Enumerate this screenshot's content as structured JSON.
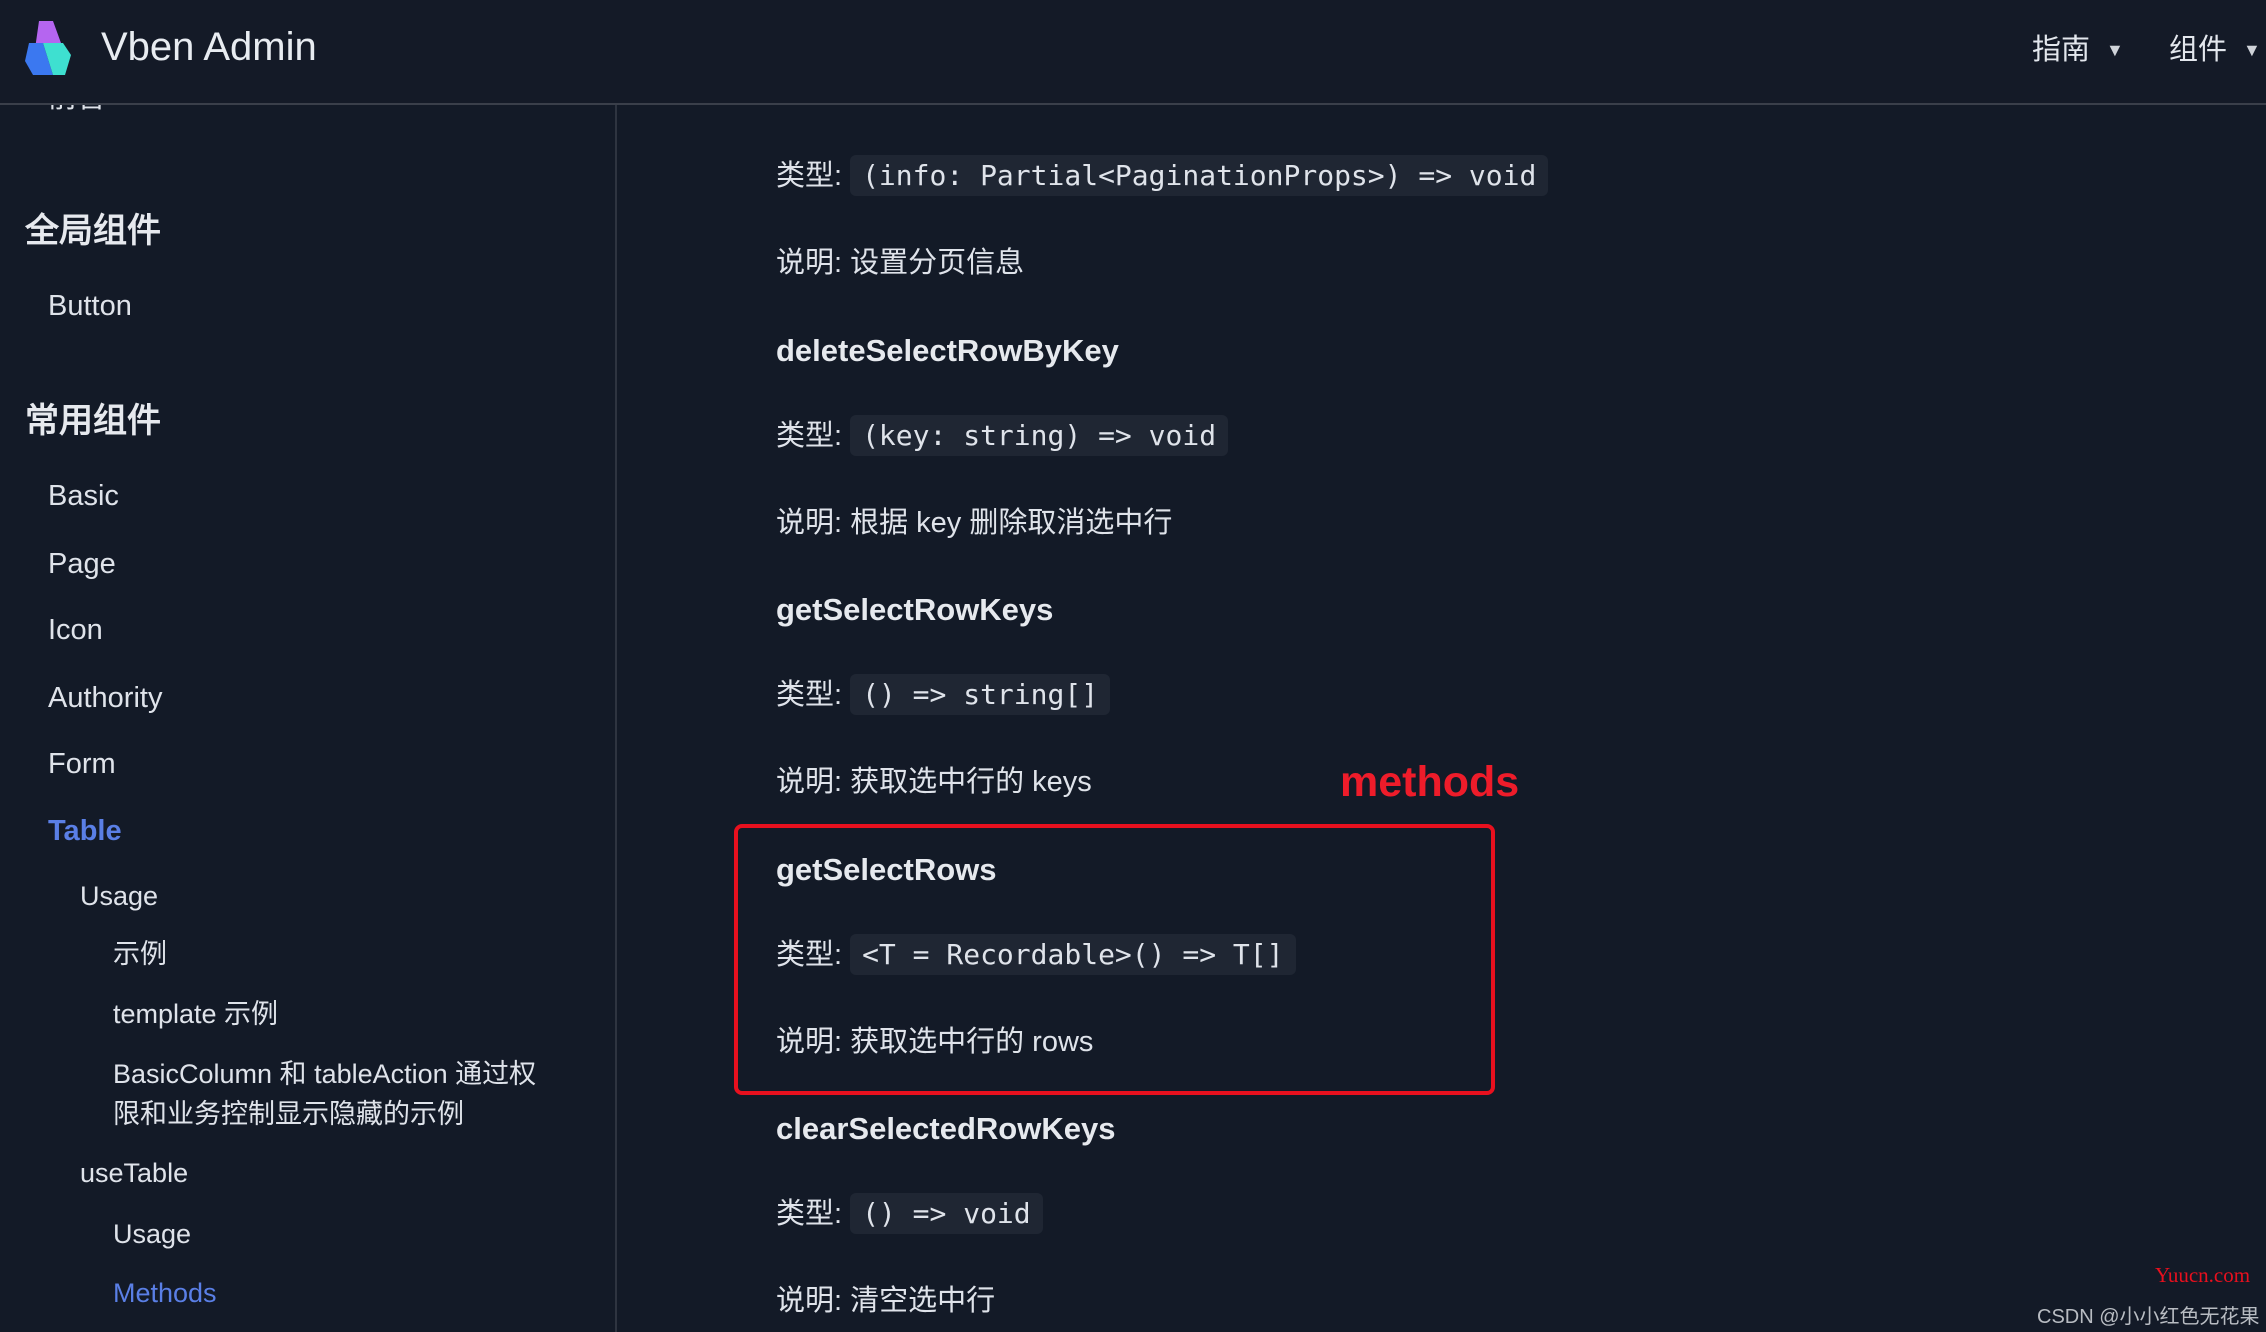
{
  "header": {
    "title": "Vben Admin",
    "nav": [
      {
        "label": "指南"
      },
      {
        "label": "组件"
      }
    ],
    "logo": "vben-logo"
  },
  "sidebar": {
    "items": [
      {
        "label": "前言"
      },
      {
        "label": "全局组件"
      },
      {
        "label": "Button"
      },
      {
        "label": "常用组件"
      },
      {
        "label": "Basic"
      },
      {
        "label": "Page"
      },
      {
        "label": "Icon"
      },
      {
        "label": "Authority"
      },
      {
        "label": "Form"
      },
      {
        "label": "Table"
      },
      {
        "label": "Usage"
      },
      {
        "label": "示例"
      },
      {
        "label": "template 示例"
      },
      {
        "label": "BasicColumn 和 tableAction 通过权"
      },
      {
        "label": "限和业务控制显示隐藏的示例"
      },
      {
        "label": "useTable"
      },
      {
        "label": "Usage"
      },
      {
        "label": "Methods"
      }
    ],
    "active_color": "#5a7fe6"
  },
  "content": {
    "type_label": "类型:",
    "desc_label": "说明:",
    "methods": [
      {
        "name": "",
        "type": "(info: Partial<PaginationProps>) => void",
        "desc": "设置分页信息"
      },
      {
        "name": "deleteSelectRowByKey",
        "type": "(key: string) => void",
        "desc": "根据 key 删除取消选中行"
      },
      {
        "name": "getSelectRowKeys",
        "type": "() => string[]",
        "desc": "获取选中行的 keys"
      },
      {
        "name": "getSelectRows",
        "type": "<T = Recordable>() => T[]",
        "desc": "获取选中行的 rows"
      },
      {
        "name": "clearSelectedRowKeys",
        "type": "() => void",
        "desc": "清空选中行"
      }
    ]
  },
  "annotation": {
    "label": "methods",
    "color": "#ee1c2a"
  },
  "watermarks": {
    "site": "Yuucn.com",
    "author": "CSDN @小小红色无花果"
  }
}
